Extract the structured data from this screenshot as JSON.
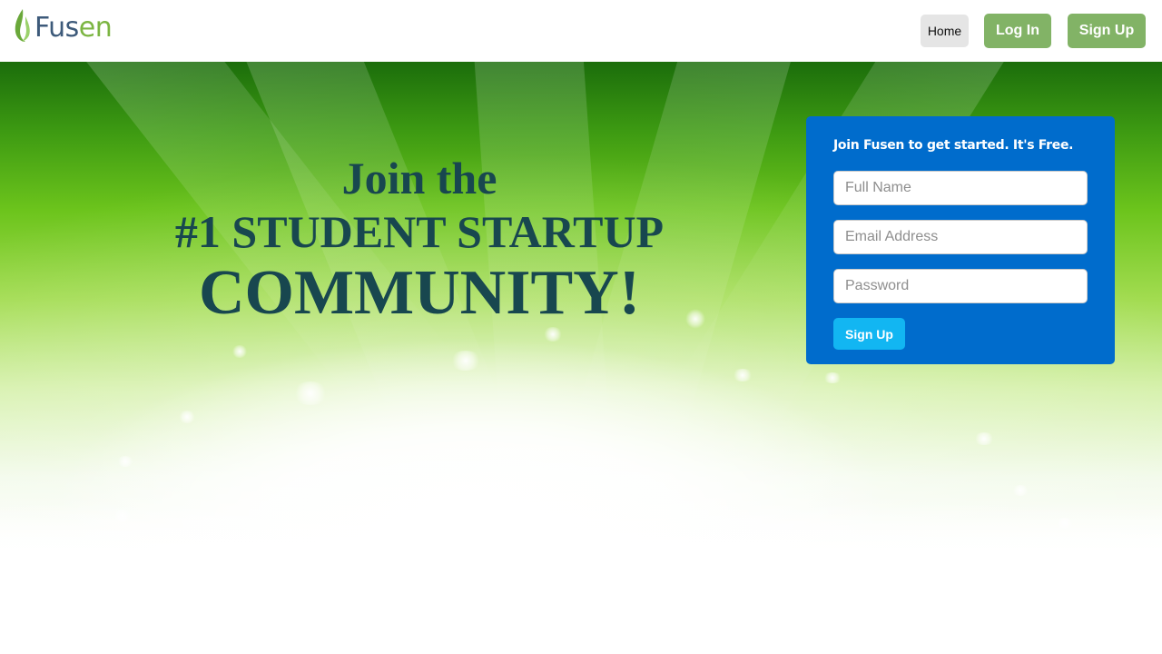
{
  "brand": {
    "name_main": "Fus",
    "name_accent": "en",
    "colors": {
      "blue": "#3d5a7a",
      "green": "#7cb542"
    },
    "logo_icon": "flame-leaf-icon"
  },
  "nav": {
    "home": "Home",
    "login": "Log In",
    "signup": "Sign Up"
  },
  "hero": {
    "line1": "Join the",
    "line2": "#1 STUDENT STARTUP",
    "line3": "COMMUNITY!",
    "text_color": "#18474f"
  },
  "signup_form": {
    "title": "Join Fusen to get started. It's Free.",
    "full_name_placeholder": "Full Name",
    "email_placeholder": "Email Address",
    "password_placeholder": "Password",
    "submit": "Sign Up",
    "card_color": "#006ccc",
    "button_color": "#12b6f2"
  }
}
